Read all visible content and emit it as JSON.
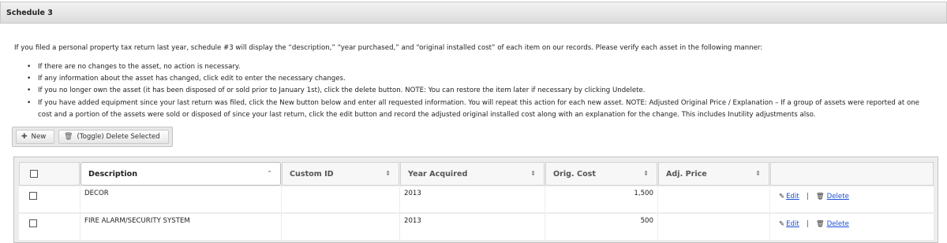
{
  "panel": {
    "title": "Schedule 3"
  },
  "intro": "If you filed a personal property tax return last year, schedule #3 will display the “description,” “year purchased,” and “original installed cost” of each item on our records. Please verify each asset in the following manner:",
  "rules": [
    "If there are no changes to the asset, no action is necessary.",
    "If any information about the asset has changed, click edit to enter the necessary changes.",
    "If you no longer own the asset (it has been disposed of or sold prior to January 1st), click the delete button. NOTE: You can restore the item later if necessary by clicking Undelete.",
    "If you have added equipment since your last return was filed, click the New button below and enter all requested information. You will repeat this action for each new asset. NOTE: Adjusted Original Price / Explanation – If a group of assets were reported at one cost and a portion of the assets were sold or disposed of since your last return, click the edit button and record the adjusted original installed cost along with an explanation for the change. This includes Inutility adjustments also."
  ],
  "toolbar": {
    "new_label": "New",
    "delete_selected_label": "(Toggle) Delete Selected"
  },
  "grid": {
    "columns": {
      "description": "Description",
      "custom_id": "Custom ID",
      "year_acquired": "Year Acquired",
      "orig_cost": "Orig. Cost",
      "adj_price": "Adj. Price"
    },
    "rows": [
      {
        "description": "DECOR",
        "custom_id": "",
        "year_acquired": "2013",
        "orig_cost": "1,500",
        "adj_price": ""
      },
      {
        "description": "FIRE ALARM/SECURITY SYSTEM",
        "custom_id": "",
        "year_acquired": "2013",
        "orig_cost": "500",
        "adj_price": ""
      }
    ],
    "actions": {
      "edit": "Edit",
      "delete": "Delete",
      "separator": "|"
    }
  },
  "icons": {
    "new": "plus-icon",
    "delete": "trash-icon",
    "edit": "pencil-icon",
    "sort_asc": "caret-up-icon",
    "sort_both": "sort-icon"
  }
}
